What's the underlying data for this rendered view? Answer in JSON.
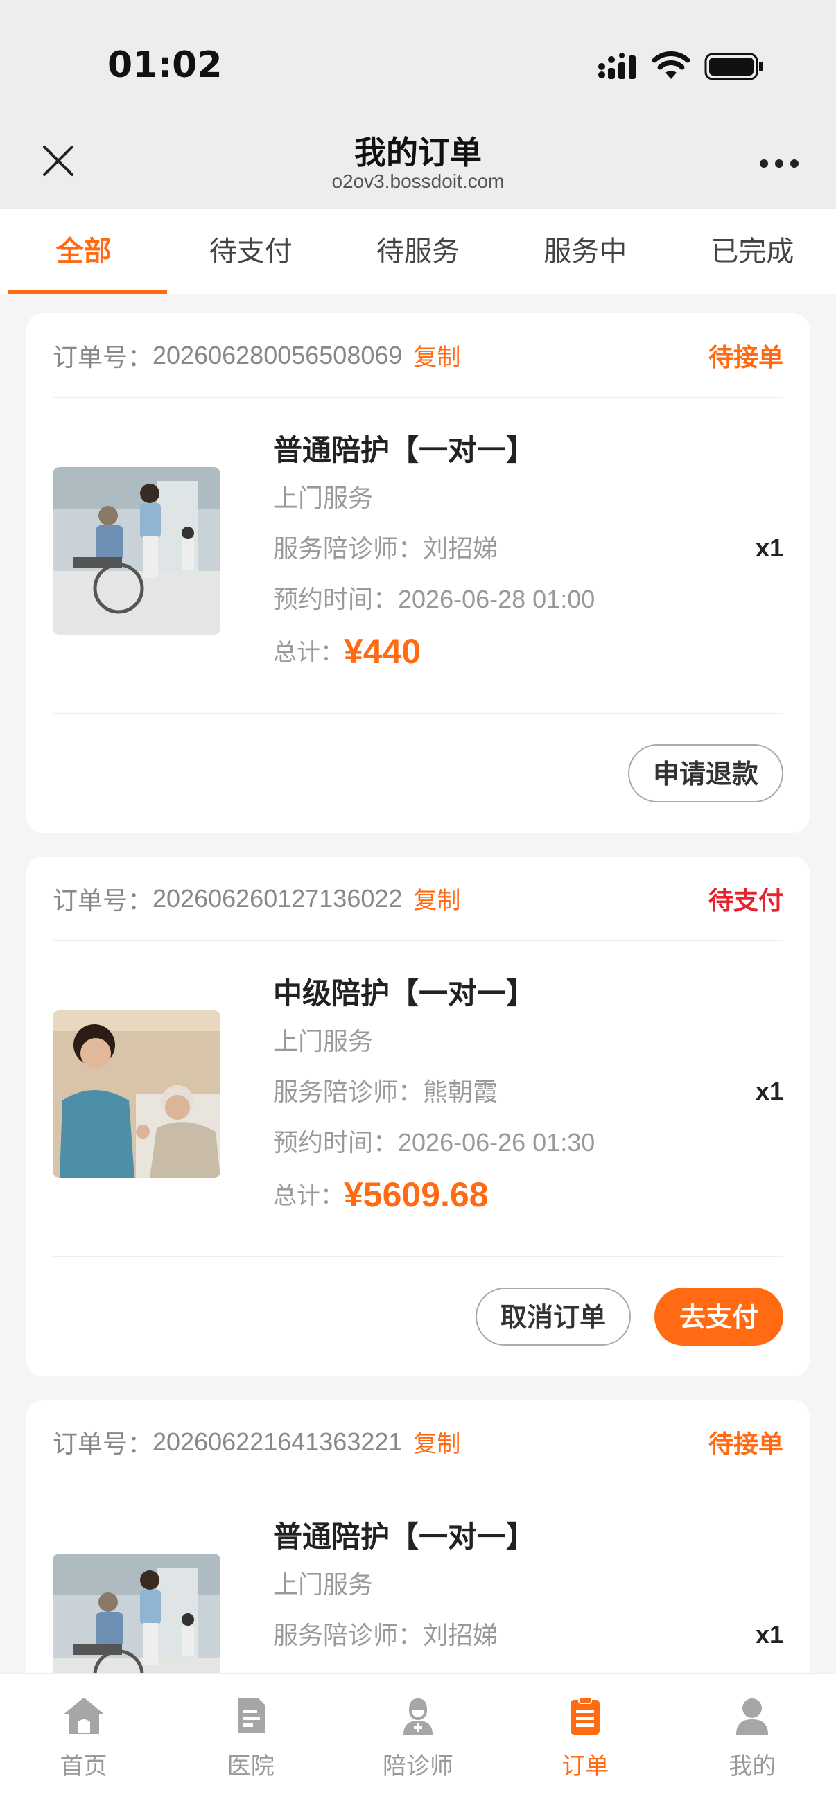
{
  "status_bar": {
    "time": "01:02"
  },
  "header": {
    "title": "我的订单",
    "subtitle": "o2ov3.bossdoit.com"
  },
  "tabs": [
    {
      "label": "全部",
      "active": true
    },
    {
      "label": "待支付",
      "active": false
    },
    {
      "label": "待服务",
      "active": false
    },
    {
      "label": "服务中",
      "active": false
    },
    {
      "label": "已完成",
      "active": false
    }
  ],
  "labels": {
    "order_no": "订单号：",
    "copy": "复制",
    "escort": "服务陪诊师：",
    "appointment": "预约时间：",
    "total": "总计："
  },
  "orders": [
    {
      "order_no": "202606280056508069",
      "status": "待接单",
      "status_color": "#ff6a12",
      "title": "普通陪护【一对一】",
      "service_type": "上门服务",
      "escort_name": "刘招娣",
      "appointment_time": "2026-06-28 01:00",
      "price": "¥440",
      "quantity": "x1",
      "image": "wheelchair-hospital-photo",
      "actions": [
        "申请退款"
      ]
    },
    {
      "order_no": "202606260127136022",
      "status": "待支付",
      "status_color": "#e8232f",
      "title": "中级陪护【一对一】",
      "service_type": "上门服务",
      "escort_name": "熊朝霞",
      "appointment_time": "2026-06-26 01:30",
      "price": "¥5609.68",
      "quantity": "x1",
      "image": "nurse-bedside-photo",
      "actions": [
        "取消订单",
        "去支付"
      ]
    },
    {
      "order_no": "202606221641363221",
      "status": "待接单",
      "status_color": "#ff6a12",
      "title": "普通陪护【一对一】",
      "service_type": "上门服务",
      "escort_name": "刘招娣",
      "quantity": "x1",
      "image": "wheelchair-hospital-photo"
    }
  ],
  "bottom_nav": [
    {
      "label": "首页",
      "icon": "home-icon",
      "active": false
    },
    {
      "label": "医院",
      "icon": "hospital-icon",
      "active": false
    },
    {
      "label": "陪诊师",
      "icon": "escort-icon",
      "active": false
    },
    {
      "label": "订单",
      "icon": "order-icon",
      "active": true
    },
    {
      "label": "我的",
      "icon": "profile-icon",
      "active": false
    }
  ],
  "colors": {
    "accent": "#ff6a12",
    "danger": "#e8232f"
  }
}
